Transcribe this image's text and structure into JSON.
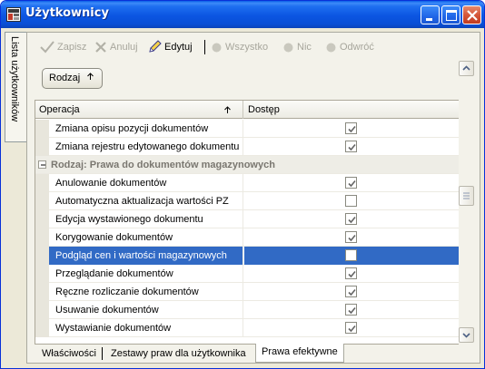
{
  "window": {
    "title": "Użytkownicy",
    "colors": {
      "titlebar": "#0b55e2",
      "selection": "#316ac5",
      "close": "#d5573a"
    }
  },
  "side_tab": {
    "label": "Lista użytkowników"
  },
  "toolbar": {
    "zapisz": "Zapisz",
    "anuluj": "Anuluj",
    "edytuj": "Edytuj",
    "wszystko": "Wszystko",
    "nic": "Nic",
    "odwroc": "Odwróć"
  },
  "group_by": {
    "label": "Rodzaj"
  },
  "grid": {
    "columns": {
      "operation": "Operacja",
      "access": "Dostęp"
    },
    "rows": [
      {
        "type": "item",
        "label": "Zmiana opisu pozycji dokumentów",
        "checked": true
      },
      {
        "type": "item",
        "label": "Zmiana rejestru edytowanego dokumentu",
        "checked": true
      },
      {
        "type": "group",
        "label": "Rodzaj: Prawa do dokumentów magazynowych"
      },
      {
        "type": "item",
        "label": "Anulowanie dokumentów",
        "checked": true
      },
      {
        "type": "item",
        "label": "Automatyczna aktualizacja wartości PZ",
        "checked": false
      },
      {
        "type": "item",
        "label": "Edycja wystawionego dokumentu",
        "checked": true
      },
      {
        "type": "item",
        "label": "Korygowanie dokumentów",
        "checked": true
      },
      {
        "type": "item",
        "label": "Podgląd cen i wartości magazynowych",
        "checked": false,
        "selected": true
      },
      {
        "type": "item",
        "label": "Przeglądanie dokumentów",
        "checked": true
      },
      {
        "type": "item",
        "label": "Ręczne rozliczanie dokumentów",
        "checked": true
      },
      {
        "type": "item",
        "label": "Usuwanie dokumentów",
        "checked": true
      },
      {
        "type": "item",
        "label": "Wystawianie dokumentów",
        "checked": true
      }
    ]
  },
  "bottom_tabs": [
    {
      "label": "Właściwości",
      "active": false
    },
    {
      "label": "Zestawy praw dla użytkownika",
      "active": false
    },
    {
      "label": "Prawa efektywne",
      "active": true
    }
  ]
}
